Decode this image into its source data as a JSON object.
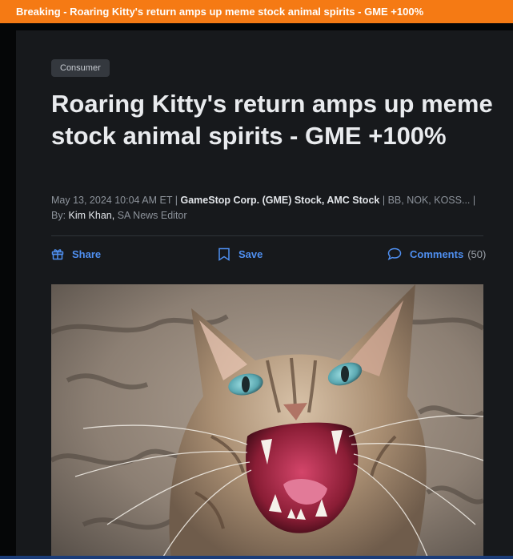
{
  "breaking": {
    "text": "Breaking - Roaring Kitty's return amps up meme stock animal spirits - GME +100%"
  },
  "article": {
    "category": "Consumer",
    "headline": "Roaring Kitty's return amps up meme stock animal spirits - GME +100%",
    "meta": {
      "datetime": "May 13, 2024 10:04 AM ET",
      "separator": "|",
      "primary_tickers": "GameStop Corp. (GME) Stock, AMC Stock",
      "other_tickers": "BB, NOK, KOSS...",
      "by_label": "By:",
      "author": "Kim Khan,",
      "author_role": "SA News Editor"
    },
    "actions": {
      "share_label": "Share",
      "save_label": "Save",
      "comments_label": "Comments",
      "comments_count": "(50)"
    },
    "hero_image": {
      "subject": "snarling tabby cat"
    }
  },
  "colors": {
    "breaking_bar": "#f57a14",
    "page_bg": "#0b0c0e",
    "card_bg": "#17191c",
    "accent_link": "#4f8ff0",
    "headline": "#e9ebee"
  },
  "icons": {
    "share": "gift-icon",
    "save": "bookmark-icon",
    "comments": "comment-bubble-icon"
  }
}
